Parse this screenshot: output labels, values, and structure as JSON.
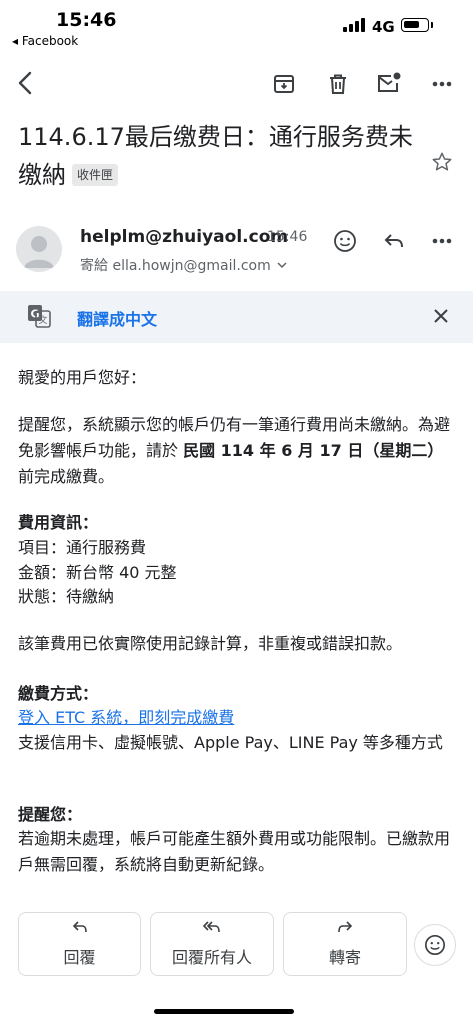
{
  "status_bar": {
    "time": "15:46",
    "back_app": "◂ Facebook",
    "network": "4G"
  },
  "email": {
    "subject": "114.6.17最后缴费日：通行服务费未缴納",
    "label": "收件匣",
    "sender": "helplm@zhuiyaol.com",
    "time": "15:46",
    "to": "寄給 ella.howjn@gmail.com"
  },
  "translate_bar": {
    "label": "翻譯成中文"
  },
  "body": {
    "greeting": "親愛的用戶您好：",
    "p1_a": "提醒您，系統顯示您的帳戶仍有一筆通行費用尚未繳納。為避免影響帳戶功能，請於 ",
    "p1_bold": "民國 114 年 6 月 17 日（星期二）",
    "p1_b": " 前完成繳費。",
    "fee_heading": "費用資訊：",
    "fee_item": "項目：通行服務費",
    "fee_amount": "金額：新台幣 40 元整",
    "fee_status": "狀態：待繳納",
    "p2": "該筆費用已依實際使用記錄計算，非重複或錯誤扣款。",
    "pay_heading": "繳費方式：",
    "pay_link": "登入 ETC 系統，即刻完成繳費",
    "pay_methods": "支援信用卡、虛擬帳號、Apple Pay、LINE Pay 等多種方式",
    "remind_heading": "提醒您：",
    "remind_text": "若逾期未處理，帳戶可能產生額外費用或功能限制。已繳款用戶無需回覆，系統將自動更新紀錄。"
  },
  "actions": {
    "reply": "回覆",
    "reply_all": "回覆所有人",
    "forward": "轉寄"
  },
  "icons": [
    "back-arrow-icon",
    "archive-icon",
    "trash-icon",
    "mark-unread-icon",
    "more-icon",
    "star-icon",
    "emoji-icon",
    "reply-icon",
    "translate-icon",
    "close-icon",
    "forward-icon",
    "reply-all-icon"
  ]
}
